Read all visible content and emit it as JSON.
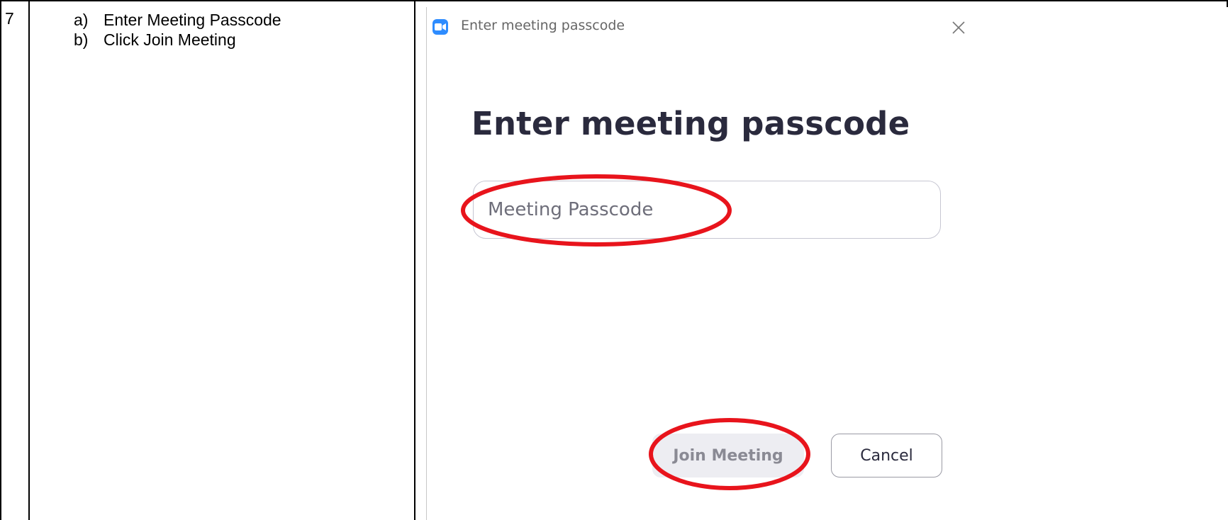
{
  "step": {
    "number": "7"
  },
  "instructions": [
    {
      "letter": "a)",
      "text": "Enter Meeting Passcode"
    },
    {
      "letter": "b)",
      "text": "Click Join Meeting"
    }
  ],
  "dialog": {
    "title": "Enter meeting passcode",
    "heading": "Enter meeting passcode",
    "passcode_placeholder": "Meeting Passcode",
    "passcode_value": "",
    "join_label": "Join Meeting",
    "cancel_label": "Cancel"
  },
  "colors": {
    "accent_icon": "#2d8cff",
    "annotation": "#e8141c",
    "heading": "#2a2a3d"
  },
  "icons": {
    "app": "zoom-camera-icon",
    "close": "close-icon"
  }
}
